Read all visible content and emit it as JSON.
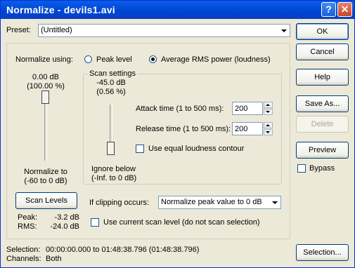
{
  "window": {
    "title": "Normalize - devils1.avi",
    "help_glyph": "?",
    "close_glyph": "✕"
  },
  "preset": {
    "label": "Preset:",
    "value": "(Untitled)"
  },
  "buttons": {
    "ok": "OK",
    "cancel": "Cancel",
    "help": "Help",
    "save_as": "Save As...",
    "delete": "Delete",
    "preview": "Preview",
    "selection": "Selection...",
    "scan_levels": "Scan Levels"
  },
  "bypass": {
    "label": "Bypass",
    "checked": false
  },
  "normalize_using": {
    "label": "Normalize using:",
    "options": [
      "Peak level",
      "Average RMS power (loudness)"
    ],
    "selected": "Average RMS power (loudness)"
  },
  "normalize_slider": {
    "value_db": "0.00 dB",
    "value_pct": "(100.00 %)",
    "caption_line1": "Normalize to",
    "caption_line2": "(-60 to 0 dB)",
    "level_fraction": 1.0
  },
  "scan_settings": {
    "title": "Scan settings",
    "value_db": "-45.0 dB",
    "value_pct": "(0.56 %)",
    "caption_line1": "Ignore below",
    "caption_line2": "(-Inf. to 0 dB)",
    "attack_label": "Attack time (1 to 500 ms):",
    "attack_value": "200",
    "release_label": "Release time (1 to 500 ms):",
    "release_value": "200",
    "equal_loudness_label": "Use equal loudness contour",
    "equal_loudness_checked": false
  },
  "clipping": {
    "label": "If clipping occurs:",
    "value": "Normalize peak value to 0 dB"
  },
  "scan_current": {
    "label": "Use current scan level (do not scan selection)",
    "checked": false
  },
  "levels": {
    "peak_label": "Peak:",
    "peak_value": "-3.2 dB",
    "rms_label": "RMS:",
    "rms_value": "-24.0 dB"
  },
  "status": {
    "selection_label": "Selection:",
    "selection_value": "00:00:00.000 to 01:48:38.796 (01:48:38.796)",
    "channels_label": "Channels:",
    "channels_value": "Both"
  }
}
